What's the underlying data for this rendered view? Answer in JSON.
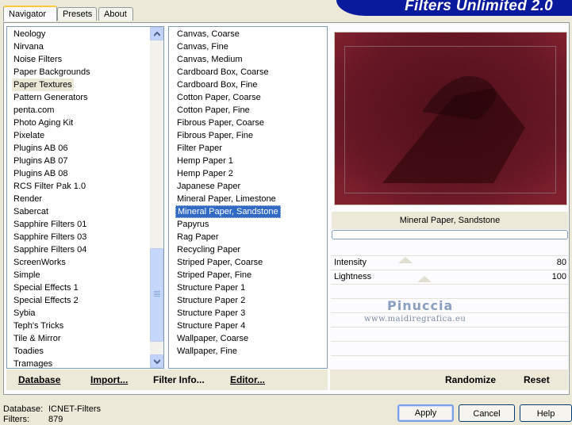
{
  "tabs": [
    "Navigator",
    "Presets",
    "About"
  ],
  "banner_title": "Filters Unlimited 2.0",
  "categories": [
    "Neology",
    "Nirvana",
    "Noise Filters",
    "Paper Backgrounds",
    "Paper Textures",
    "Pattern Generators",
    "penta.com",
    "Photo Aging Kit",
    "Pixelate",
    "Plugins AB 06",
    "Plugins AB 07",
    "Plugins AB 08",
    "RCS Filter Pak 1.0",
    "Render",
    "Sabercat",
    "Sapphire Filters 01",
    "Sapphire Filters 03",
    "Sapphire Filters 04",
    "ScreenWorks",
    "Simple",
    "Special Effects 1",
    "Special Effects 2",
    "Sybia",
    "Teph's Tricks",
    "Tile & Mirror",
    "Toadies",
    "Tramages"
  ],
  "selected_category": "Paper Textures",
  "filters": [
    "Canvas, Coarse",
    "Canvas, Fine",
    "Canvas, Medium",
    "Cardboard Box, Coarse",
    "Cardboard Box, Fine",
    "Cotton Paper, Coarse",
    "Cotton Paper, Fine",
    "Fibrous Paper, Coarse",
    "Fibrous Paper, Fine",
    "Filter Paper",
    "Hemp Paper 1",
    "Hemp Paper 2",
    "Japanese Paper",
    "Mineral Paper, Limestone",
    "Mineral Paper, Sandstone",
    "Papyrus",
    "Rag Paper",
    "Recycling Paper",
    "Striped Paper, Coarse",
    "Striped Paper, Fine",
    "Structure Paper 1",
    "Structure Paper 2",
    "Structure Paper 3",
    "Structure Paper 4",
    "Wallpaper, Coarse",
    "Wallpaper, Fine"
  ],
  "selected_filter": "Mineral Paper, Sandstone",
  "preview_caption": "Mineral Paper, Sandstone",
  "progress": 0,
  "params": [
    {
      "label": "Intensity",
      "value": "80",
      "level": 80
    },
    {
      "label": "Lightness",
      "value": "100",
      "level": 100
    }
  ],
  "watermark": {
    "name": "Pinuccia",
    "url": "www.maidiregrafica.eu"
  },
  "left_buttons": [
    "Database",
    "Import...",
    "Filter Info...",
    "Editor..."
  ],
  "right_buttons": [
    "Randomize",
    "Reset"
  ],
  "status": {
    "database_label": "Database:",
    "database_value": "ICNET-Filters",
    "filters_label": "Filters:",
    "filters_value": "879"
  },
  "dialog_buttons": [
    "Apply",
    "Cancel",
    "Help"
  ],
  "colors": {
    "banner": "#0a1a9c",
    "highlight": "#316ac5",
    "preview": "#4a0e14"
  }
}
